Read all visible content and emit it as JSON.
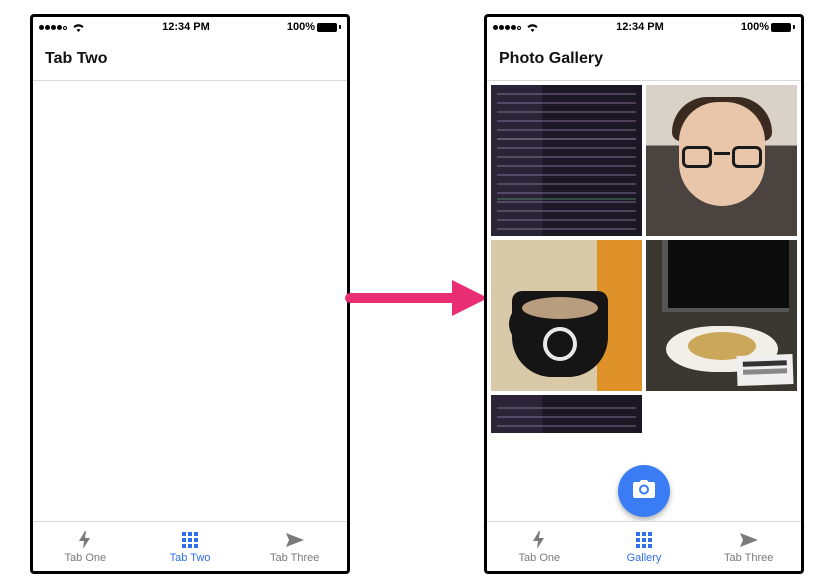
{
  "status": {
    "time": "12:34 PM",
    "battery": "100%"
  },
  "screenA": {
    "title": "Tab Two",
    "tabs": [
      {
        "label": "Tab One",
        "icon": "bolt-icon",
        "active": false
      },
      {
        "label": "Tab Two",
        "icon": "grid-icon",
        "active": true
      },
      {
        "label": "Tab Three",
        "icon": "send-icon",
        "active": false
      }
    ]
  },
  "screenB": {
    "title": "Photo Gallery",
    "photos": [
      {
        "name": "code-editor-photo"
      },
      {
        "name": "selfie-glasses-photo"
      },
      {
        "name": "black-mug-photo"
      },
      {
        "name": "bowl-desk-photo"
      },
      {
        "name": "code-editor-photo-2"
      }
    ],
    "fab_icon": "camera-icon",
    "tabs": [
      {
        "label": "Tab One",
        "icon": "bolt-icon",
        "active": false
      },
      {
        "label": "Gallery",
        "icon": "grid-icon",
        "active": true
      },
      {
        "label": "Tab Three",
        "icon": "send-icon",
        "active": false
      }
    ]
  },
  "colors": {
    "accent": "#2f6fe8",
    "fab": "#3a7cf4",
    "arrow": "#ea2e74"
  }
}
